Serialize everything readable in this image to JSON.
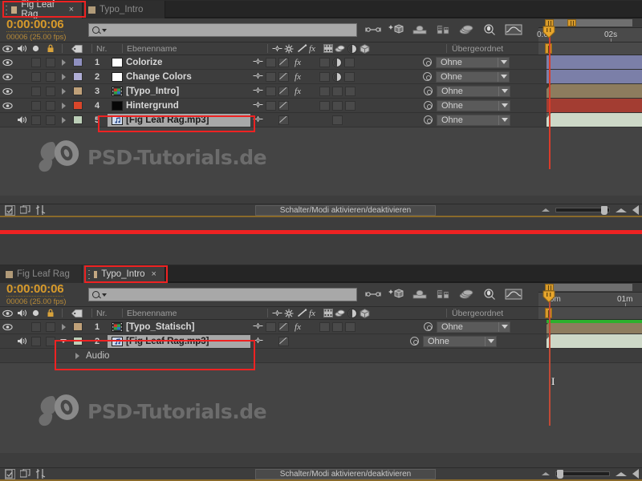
{
  "app": {
    "name": "Adobe After Effects Timeline"
  },
  "panels": [
    {
      "id": "top",
      "tabs": [
        {
          "label": "Fig Leaf Rag",
          "selected": true,
          "close": "×",
          "swatch": "#c4a882"
        },
        {
          "label": "Typo_Intro",
          "selected": false,
          "close": "",
          "swatch": "#b5a184"
        }
      ],
      "timecode": {
        "main": "0:00:00:06",
        "sub": "00006 (25.00 fps)"
      },
      "search": {
        "placeholder": "",
        "value": ""
      },
      "columns": {
        "nr": "Nr.",
        "layername": "Ebenenname",
        "parent": "Übergeordnet"
      },
      "ruler": {
        "left_label": "0:0",
        "ticks": [
          "02s"
        ]
      },
      "layers": [
        {
          "nr": "1",
          "name": "Colorize",
          "swatch": "#8f90c0",
          "src_type": "solid-white",
          "eye": true,
          "audio": false,
          "fx": true,
          "blend": true,
          "bar_color": "#7b7fa8",
          "parent": "Ohne",
          "twirl": "right"
        },
        {
          "nr": "2",
          "name": "Change Colors",
          "swatch": "#b0aed6",
          "src_type": "solid-white",
          "eye": true,
          "audio": false,
          "fx": true,
          "blend": true,
          "bar_color": "#7b7fa8",
          "parent": "Ohne",
          "twirl": "right"
        },
        {
          "nr": "3",
          "name": "[Typo_Intro]",
          "swatch": "#c0a179",
          "src_type": "comp",
          "eye": true,
          "audio": false,
          "fx": true,
          "blend": false,
          "bar_color": "#8d7c5e",
          "parent": "Ohne",
          "twirl": "right"
        },
        {
          "nr": "4",
          "name": "Hintergrund",
          "swatch": "#d9462a",
          "src_type": "solid-black",
          "eye": true,
          "audio": false,
          "fx": false,
          "blend": false,
          "bar_color": "#a33d32",
          "parent": "Ohne",
          "twirl": "right"
        },
        {
          "nr": "5",
          "name": "[Fig Leaf Rag.mp3]",
          "swatch": "#bccfb8",
          "src_type": "audio",
          "eye": false,
          "audio": true,
          "fx": false,
          "blend": false,
          "bar_color": "#cdd8c7",
          "parent": "Ohne",
          "twirl": "right",
          "selected": true
        }
      ],
      "statusbar": {
        "switch_modes": "Schalter/Modi aktivieren/deaktivieren"
      }
    },
    {
      "id": "bottom",
      "tabs": [
        {
          "label": "Fig Leaf Rag",
          "selected": false,
          "close": "",
          "swatch": "#b5a184"
        },
        {
          "label": "Typo_Intro",
          "selected": true,
          "close": "×",
          "swatch": "#c4a882"
        }
      ],
      "timecode": {
        "main": "0:00:00:06",
        "sub": "00006 (25.00 fps)"
      },
      "search": {
        "placeholder": "",
        "value": ""
      },
      "columns": {
        "nr": "Nr.",
        "layername": "Ebenenname",
        "parent": "Übergeordnet"
      },
      "ruler": {
        "left_label": "0m",
        "ticks": [
          "01m"
        ]
      },
      "layers": [
        {
          "nr": "1",
          "name": "[Typo_Statisch]",
          "swatch": "#c0a179",
          "src_type": "comp",
          "eye": true,
          "audio": false,
          "fx": true,
          "blend": false,
          "bar_color": "#2db02d",
          "parent": "Ohne",
          "twirl": "right"
        },
        {
          "nr": "2",
          "name": "[Fig Leaf Rag.mp3]",
          "swatch": "#bccfb8",
          "src_type": "audio",
          "eye": false,
          "audio": true,
          "fx": false,
          "blend": false,
          "bar_color": "#8d7c5e",
          "parent": "Ohne",
          "twirl": "down",
          "selected": true
        },
        {
          "nr": "",
          "name": "Audio",
          "is_property": true,
          "bar_color": "#cdd8c7",
          "twirl": "right"
        }
      ],
      "statusbar": {
        "switch_modes": "Schalter/Modi aktivieren/deaktivieren"
      }
    }
  ],
  "watermark": {
    "text": "PSD-Tutorials.de"
  },
  "annotations": {
    "color": "#ee2222",
    "notes": [
      "top tab Fig Leaf Rag highlighted",
      "top layer 5 Fig Leaf Rag.mp3 highlighted",
      "divider line between panels",
      "bottom tab Typo_Intro highlighted",
      "bottom layers 2 and Audio highlighted"
    ]
  }
}
